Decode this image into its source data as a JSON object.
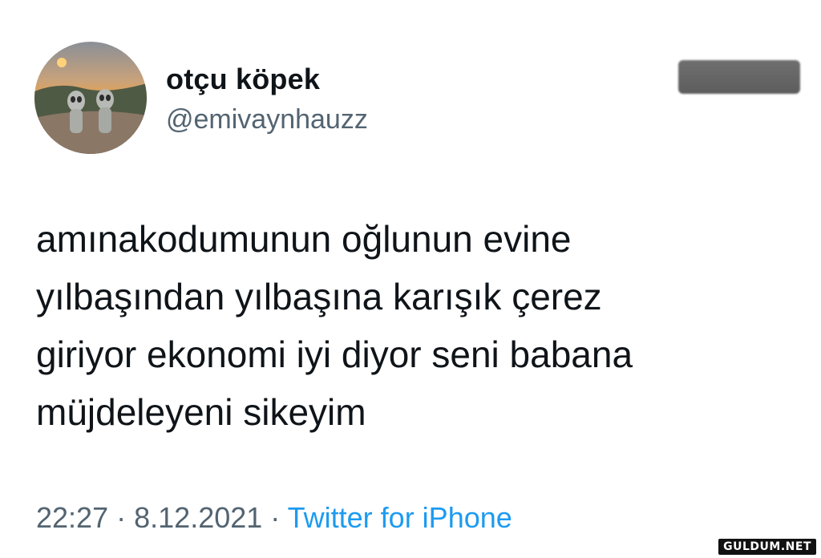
{
  "user": {
    "display_name": "otçu köpek",
    "handle": "@emivaynhauzz"
  },
  "tweet": {
    "lines": [
      "amınakodumunun oğlunun evine",
      "yılbaşından yılbaşına karışık çerez",
      "giriyor ekonomi iyi diyor seni babana",
      "müjdeleyeni sikeyim"
    ]
  },
  "meta": {
    "time": "22:27",
    "separator": "·",
    "date": "8.12.2021",
    "source": "Twitter for iPhone"
  },
  "watermark": "GULDUM.NET",
  "colors": {
    "text": "#0f1419",
    "secondary": "#536471",
    "link": "#1d9bf0",
    "background": "#ffffff"
  }
}
